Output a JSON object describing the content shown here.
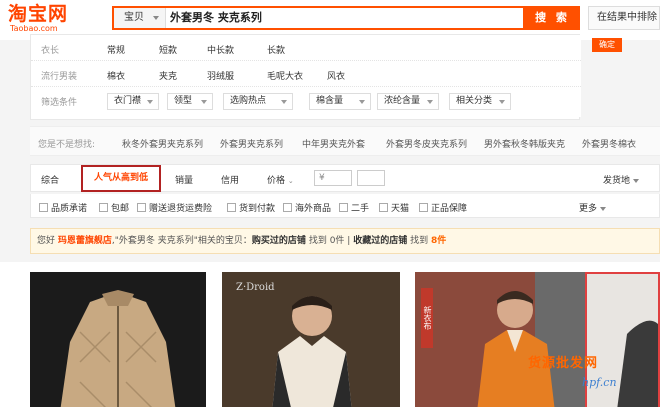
{
  "header": {
    "logo_text": "淘宝网",
    "logo_sub": "Taobao.com",
    "search_scope": "宝贝",
    "search_value": "外套男冬 夹克系列",
    "search_button": "搜 索",
    "within_results": "在结果中排除",
    "confirm_button": "确定"
  },
  "filters": {
    "row1": {
      "label": "衣长",
      "options": [
        "常规",
        "短款",
        "中长款",
        "长款"
      ]
    },
    "row2": {
      "label": "流行男装",
      "options": [
        "棉衣",
        "夹克",
        "羽绒服",
        "毛呢大衣",
        "风衣"
      ]
    },
    "row3": {
      "label": "筛选条件",
      "dropdowns": [
        "衣门襟",
        "领型",
        "选购热点",
        "棉含量",
        "浓纶含量",
        "相关分类"
      ]
    }
  },
  "suggestions": {
    "label": "您是不是想找:",
    "items": [
      "秋冬外套男夹克系列",
      "外套男夹克系列",
      "中年男夹克外套",
      "外套男冬皮夹克系列",
      "男外套秋冬韩版夹克",
      "外套男冬棉衣"
    ]
  },
  "sortbar": {
    "items": [
      "综合",
      "人气从高到低",
      "销量",
      "信用",
      "价格"
    ],
    "price_placeholder": "¥",
    "ship_from": "发货地"
  },
  "checkboxes": {
    "items": [
      "品质承诺",
      "包邮",
      "赠送退货运费险",
      "货到付款",
      "海外商品",
      "二手",
      "天猫",
      "正品保障"
    ],
    "more": "更多"
  },
  "notice": {
    "prefix": "您好",
    "shop": "玛恩蕾旗舰店",
    "text1": ",\"外套男冬 夹克系列\"相关的宝贝：",
    "bought": "购买过的店铺",
    "found1": "找到",
    "count1": "0件",
    "sep": " | ",
    "fav": "收藏过的店铺",
    "found2": "找到",
    "count2": "8件"
  },
  "products": {
    "p2_brand": "Z·Droid",
    "p3_sign": "新衣布"
  },
  "watermark": {
    "main": "货源批发网",
    "sub": "hpf.cn"
  }
}
